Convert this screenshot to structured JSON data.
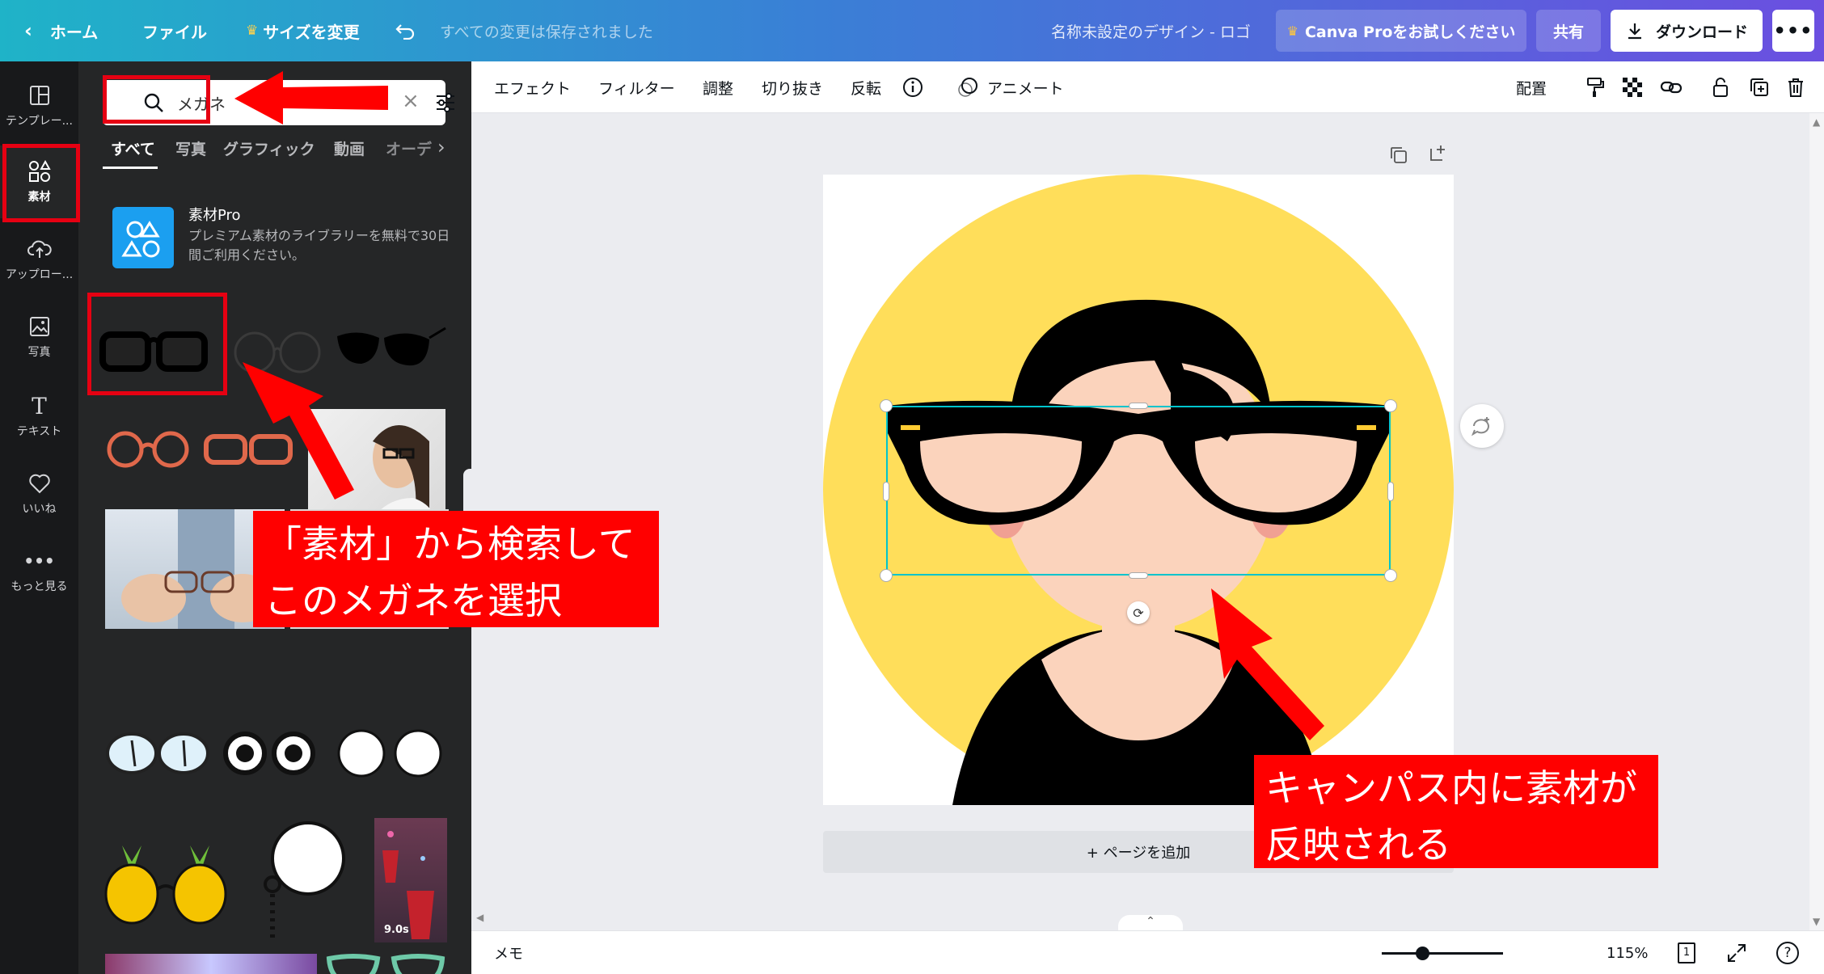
{
  "topbar": {
    "home": "ホーム",
    "file": "ファイル",
    "resize": "サイズを変更",
    "saved_status": "すべての変更は保存されました",
    "doc_title": "名称未設定のデザイン - ロゴ",
    "pro_button": "Canva Proをお試しください",
    "share_button": "共有",
    "download_button": "ダウンロード"
  },
  "rail": {
    "items": [
      {
        "label": "テンプレー..."
      },
      {
        "label": "素材"
      },
      {
        "label": "アップロー..."
      },
      {
        "label": "写真"
      },
      {
        "label": "テキスト"
      },
      {
        "label": "いいね"
      },
      {
        "label": "もっと見る"
      }
    ]
  },
  "panel": {
    "search_value": "メガネ",
    "tabs": [
      "すべて",
      "写真",
      "グラフィック",
      "動画",
      "オーデ"
    ],
    "pro": {
      "title": "素材Pro",
      "desc": "プレミアム素材のライブラリーを無料で30日間ご利用ください。"
    },
    "video_duration": "9.0s"
  },
  "toolbar2": {
    "effect": "エフェクト",
    "filter": "フィルター",
    "adjust": "調整",
    "crop": "切り抜き",
    "flip": "反転",
    "animate": "アニメート",
    "position": "配置"
  },
  "canvas": {
    "add_page": "+ ページを追加"
  },
  "bottombar": {
    "notes": "メモ",
    "zoom": "115%",
    "page_number": "1",
    "help": "?"
  },
  "annotations": {
    "left_line1": "「素材」から検索して",
    "left_line2": "このメガネを選択",
    "right_line1": "キャンパス内に素材が",
    "right_line2": "反映される"
  },
  "colors": {
    "annotation_red": "#ff0000",
    "panel_bg": "#252627",
    "rail_bg": "#18191b",
    "artwork_yellow": "#ffde5a",
    "skin": "#fbd3bc",
    "selection": "#00c4cc"
  }
}
